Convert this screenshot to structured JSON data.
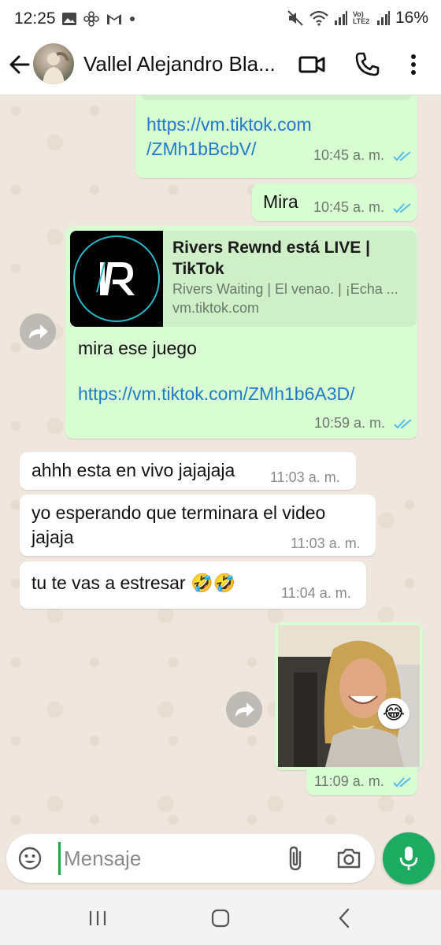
{
  "status_bar": {
    "time": "12:25",
    "signal_label": "Vo) LTE2",
    "battery": "16%"
  },
  "header": {
    "contact_name": "Vallel Alejandro Bla..."
  },
  "messages": [
    {
      "type": "outgoing",
      "text_line1": "https://vm.tiktok.com",
      "text_line2": "/ZMh1bBcbV/",
      "time": "10:45 a. m."
    },
    {
      "type": "outgoing",
      "text": "Mira",
      "time": "10:45 a. m."
    },
    {
      "type": "outgoing",
      "preview_title": "Rivers Rewnd está LIVE | TikTok",
      "preview_desc": "Rivers Waiting | El venao. | ¡Echa ...",
      "preview_domain": "vm.tiktok.com",
      "text": "mira ese juego",
      "link": "https://vm.tiktok.com/ZMh1b6A3D/",
      "time": "10:59 a. m."
    },
    {
      "type": "incoming",
      "text": "ahhh esta en vivo jajajaja",
      "time": "11:03 a. m."
    },
    {
      "type": "incoming",
      "text_line1": "yo esperando que terminara el video",
      "text_line2": "jajaja",
      "time": "11:03 a. m."
    },
    {
      "type": "incoming",
      "text": "tu te vas a estresar 🤣🤣",
      "time": "11:04 a. m."
    },
    {
      "type": "outgoing-photo",
      "time": "11:09 a. m.",
      "reaction": "😂"
    }
  ],
  "composer": {
    "placeholder": "Mensaje"
  },
  "colors": {
    "outgoing_bubble": "#d9fdd3",
    "incoming_bubble": "#ffffff",
    "accent_green": "#1daa61",
    "link_blue": "#1f7bc6",
    "read_ticks": "#53bdeb"
  },
  "icons": {
    "back": "arrow-left-icon",
    "video_call": "video-camera-icon",
    "voice_call": "phone-icon",
    "menu": "more-vertical-icon",
    "forward": "forward-icon",
    "emoji": "emoji-icon",
    "attach": "paperclip-icon",
    "camera": "camera-icon",
    "mic": "microphone-icon"
  }
}
